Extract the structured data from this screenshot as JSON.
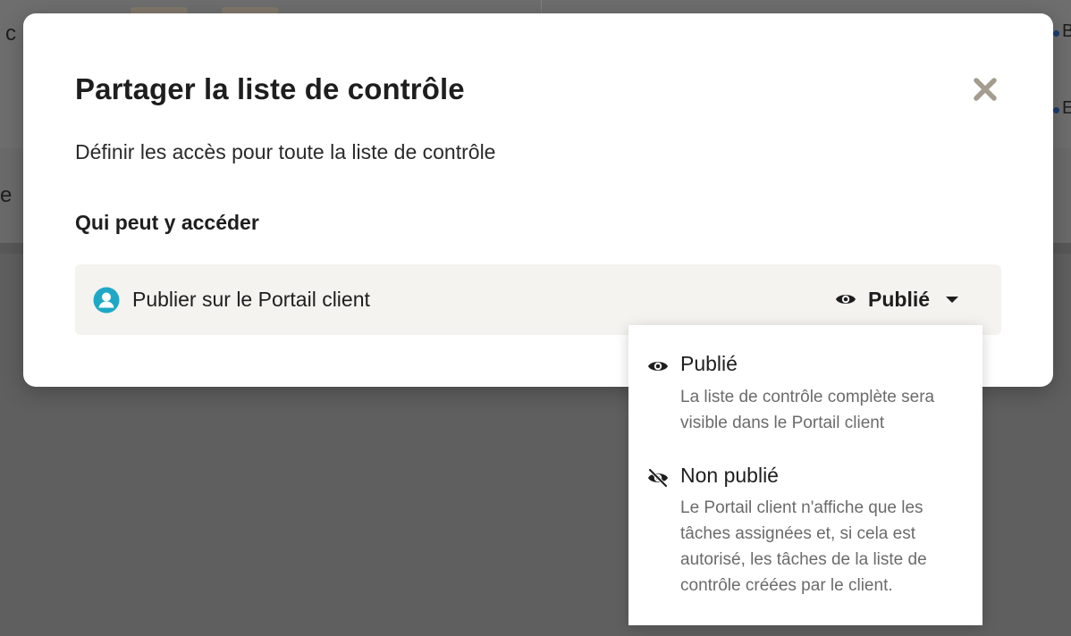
{
  "background": {
    "fragment_top": "c",
    "fragment_mid": "e",
    "fragment_right_top": "B",
    "fragment_right_mid": "E"
  },
  "modal": {
    "title": "Partager la liste de contrôle",
    "subtitle": "Définir les accès pour toute la liste de contrôle",
    "section_label": "Qui peut y accéder",
    "close_icon": "close-icon",
    "row": {
      "icon": "user-circle-icon",
      "label": "Publier sur le Portail client",
      "status_icon": "eye-icon",
      "status_label": "Publié"
    }
  },
  "dropdown": {
    "options": [
      {
        "icon": "eye-icon",
        "title": "Publié",
        "description": "La liste de contrôle complète sera visible dans le Portail client"
      },
      {
        "icon": "eye-slash-icon",
        "title": "Non publié",
        "description": "Le Portail client n'affiche que les tâches assignées et, si cela est autorisé, les tâches de la liste de contrôle créées par le client."
      }
    ]
  },
  "colors": {
    "overlay": "#5f5f5f",
    "row_background": "#f5f3ef",
    "accent_teal": "#1fa8c6",
    "close_icon": "#a39c8f"
  }
}
